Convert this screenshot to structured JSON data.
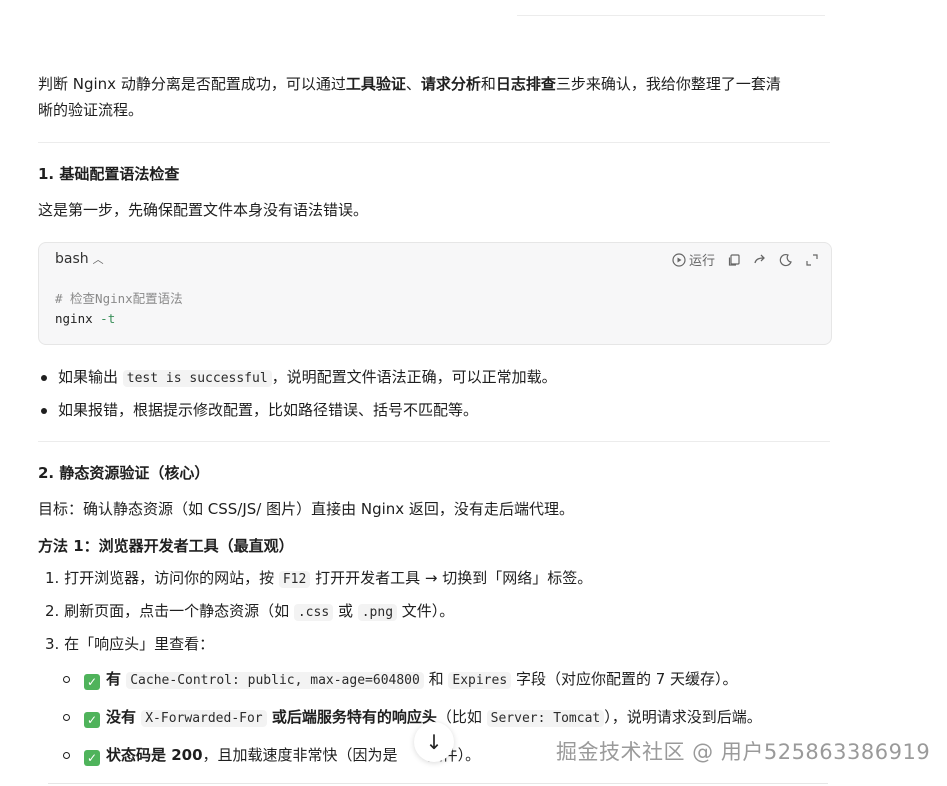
{
  "intro": {
    "t1": "判断 Nginx 动静分离是否配置成功，可以通过",
    "b1": "工具验证",
    "t2": "、",
    "b2": "请求分析",
    "t3": "和",
    "b3": "日志排查",
    "t4": "三步来确认，我给你整理了一套清",
    "line2": "晰的验证流程。"
  },
  "section1": {
    "heading": "1. 基础配置语法检查",
    "desc": "这是第一步，先确保配置文件本身没有语法错误。"
  },
  "codeblock": {
    "lang": "bash",
    "run_label": "运行",
    "comment": "# 检查Nginx配置语法",
    "cmd": "nginx",
    "flag": "-t"
  },
  "bullets": [
    {
      "pre": "如果输出 ",
      "code": "test is successful",
      "post": "，说明配置文件语法正确，可以正常加载。"
    },
    {
      "text": "如果报错，根据提示修改配置，比如路径错误、括号不匹配等。"
    }
  ],
  "section2": {
    "heading": "2. 静态资源验证（核心）",
    "goal": "目标：确认静态资源（如 CSS/JS/ 图片）直接由 Nginx 返回，没有走后端代理。",
    "method1": "方法 1：浏览器开发者工具（最直观）"
  },
  "steps": [
    {
      "pre": "1. 打开浏览器，访问你的网站，按 ",
      "code": "F12",
      "post": " 打开开发者工具 → 切换到「网络」标签。"
    },
    {
      "pre": "2. 刷新页面，点击一个静态资源（如 ",
      "code": ".css",
      "mid": " 或 ",
      "code2": ".png",
      "post": " 文件）。"
    },
    {
      "text": "3. 在「响应头」里查看："
    }
  ],
  "checks": [
    {
      "bold": "有 ",
      "code": "Cache-Control: public, max-age=604800",
      "mid": " 和 ",
      "code2": "Expires",
      "post": " 字段（对应你配置的 7 天缓存）。"
    },
    {
      "bold": "没有 ",
      "code": "X-Forwarded-For",
      "bold2": " 或后端服务特有的响应头",
      "mid": "（比如 ",
      "code2": "Server: Tomcat",
      "post": "），说明请求没到后端。"
    },
    {
      "bold": "状态码是 200",
      "post": "，且加载速度非常快（因为是",
      "post2": "文件）。"
    }
  ],
  "watermark": "掘金技术社区 @ 用户525863386919"
}
